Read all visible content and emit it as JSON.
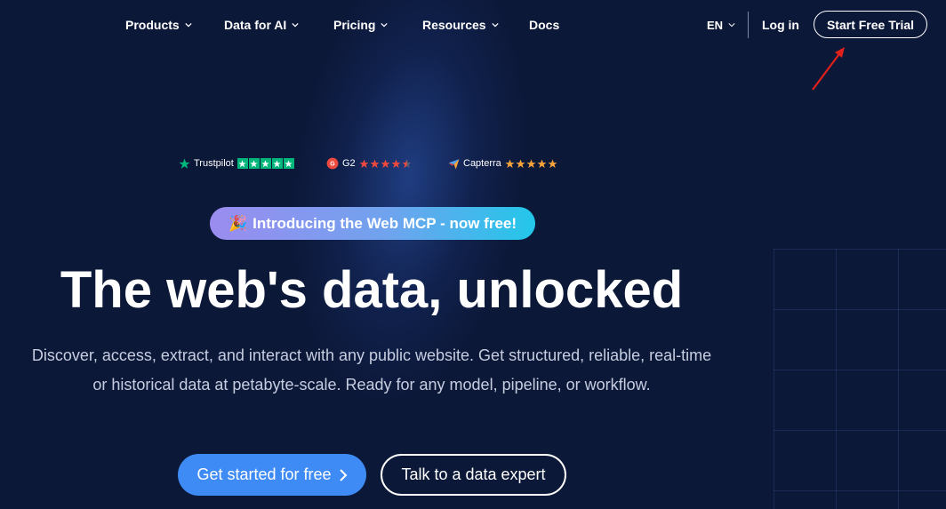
{
  "nav": {
    "items": [
      {
        "label": "Products",
        "has_dropdown": true
      },
      {
        "label": "Data for AI",
        "has_dropdown": true
      },
      {
        "label": "Pricing",
        "has_dropdown": true
      },
      {
        "label": "Resources",
        "has_dropdown": true
      },
      {
        "label": "Docs",
        "has_dropdown": false
      }
    ],
    "language": "EN",
    "login_label": "Log in",
    "trial_label": "Start Free Trial"
  },
  "ratings": [
    {
      "name": "Trustpilot",
      "stars": 5
    },
    {
      "name": "G2",
      "stars": 4.5
    },
    {
      "name": "Capterra",
      "stars": 5
    }
  ],
  "announcement": {
    "emoji": "🎉",
    "text": "Introducing the Web MCP - now free!"
  },
  "hero": {
    "headline": "The web's data, unlocked",
    "subtitle_line1": "Discover, access, extract, and interact with any public website. Get structured, reliable, real-time",
    "subtitle_line2": "or historical data at petabyte-scale. Ready for any model, pipeline, or workflow."
  },
  "cta": {
    "primary_label": "Get started for free",
    "secondary_label": "Talk to a data expert"
  },
  "colors": {
    "background": "#0c1838",
    "trustpilot_green": "#00b67a",
    "g2_red": "#f0493d",
    "capterra_orange": "#f4a43b",
    "primary_blue": "#3f8bf5",
    "annotation_arrow": "#e0201b"
  }
}
